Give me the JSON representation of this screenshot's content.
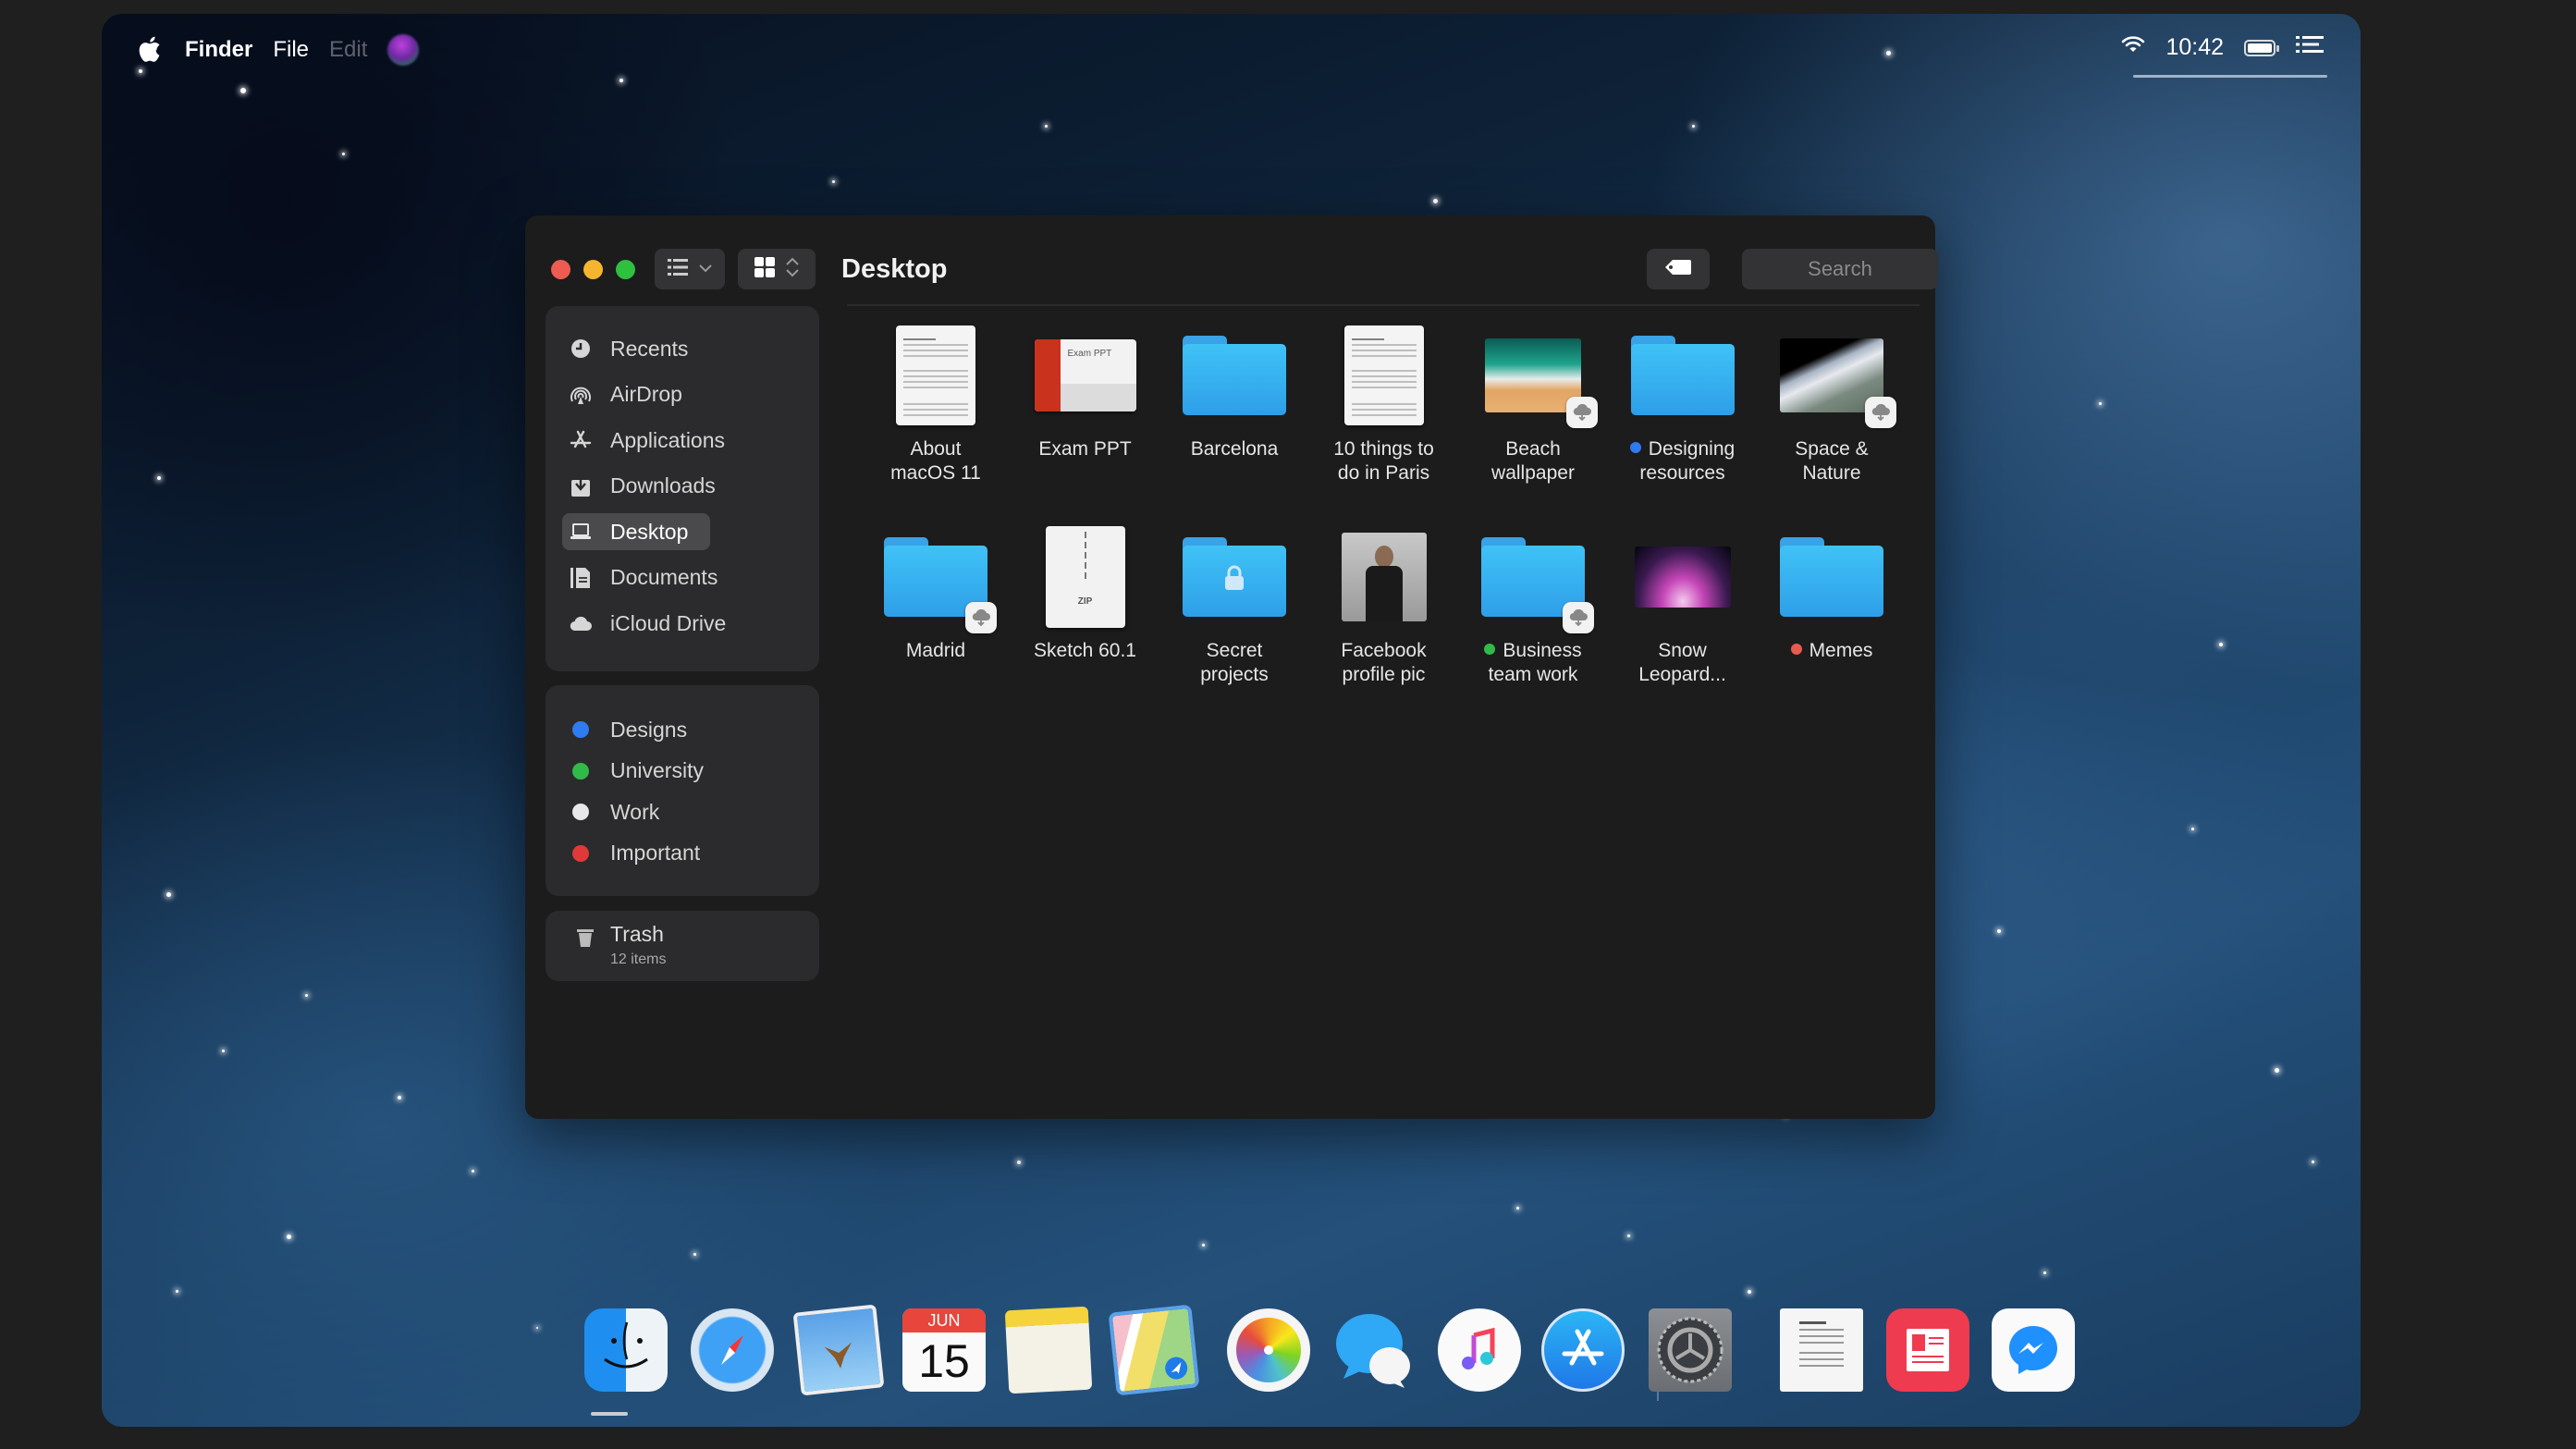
{
  "menubar": {
    "apple_icon": "apple-logo-icon",
    "app_name": "Finder",
    "items": [
      "File",
      "Edit"
    ],
    "time": "10:42",
    "status_icons": [
      "wifi-icon",
      "battery-icon",
      "control-center-list-icon"
    ]
  },
  "window": {
    "title": "Desktop",
    "view_buttons": [
      {
        "name": "list-view",
        "icon": "list-icon",
        "dropdown": "chevron-down-icon"
      },
      {
        "name": "icon-view",
        "icon": "grid-icon",
        "dropdown": "chevron-updown-icon"
      }
    ],
    "tag_button_icon": "tag-icon",
    "search_placeholder": "Search"
  },
  "sidebar": {
    "favorites": [
      {
        "label": "Recents",
        "icon": "clock-icon",
        "active": false
      },
      {
        "label": "AirDrop",
        "icon": "airdrop-icon",
        "active": false
      },
      {
        "label": "Applications",
        "icon": "applications-icon",
        "active": false
      },
      {
        "label": "Downloads",
        "icon": "download-icon",
        "active": false
      },
      {
        "label": "Desktop",
        "icon": "desktop-icon",
        "active": true
      },
      {
        "label": "Documents",
        "icon": "documents-icon",
        "active": false
      },
      {
        "label": "iCloud Drive",
        "icon": "cloud-icon",
        "active": false
      }
    ],
    "tags": [
      {
        "label": "Designs",
        "color": "#2f7bf0"
      },
      {
        "label": "University",
        "color": "#31b94a"
      },
      {
        "label": "Work",
        "color": "#e8e8e8"
      },
      {
        "label": "Important",
        "color": "#e0393a"
      }
    ],
    "trash": {
      "label": "Trash",
      "count": "12 items"
    }
  },
  "files": [
    {
      "name": "About macOS 11",
      "line1": "About",
      "line2": "macOS 11",
      "kind": "document",
      "tag": null,
      "cloud": false
    },
    {
      "name": "Exam PPT",
      "line1": "Exam PPT",
      "line2": "",
      "kind": "presentation",
      "tag": null,
      "cloud": false,
      "thumb_text": "Exam PPT"
    },
    {
      "name": "Barcelona",
      "line1": "Barcelona",
      "line2": "",
      "kind": "folder",
      "tag": null,
      "cloud": false
    },
    {
      "name": "10 things to do in Paris",
      "line1": "10 things to",
      "line2": "do in Paris",
      "kind": "document",
      "tag": null,
      "cloud": false
    },
    {
      "name": "Beach wallpaper",
      "line1": "Beach",
      "line2": "wallpaper",
      "kind": "image",
      "tag": null,
      "cloud": true
    },
    {
      "name": "Designing resources",
      "line1": "Designing",
      "line2": "resources",
      "kind": "folder",
      "tag": "#2f7bf0",
      "cloud": false
    },
    {
      "name": "Space & Nature",
      "line1": "Space &",
      "line2": "Nature",
      "kind": "image",
      "tag": null,
      "cloud": true
    },
    {
      "name": "Madrid",
      "line1": "Madrid",
      "line2": "",
      "kind": "folder",
      "tag": null,
      "cloud": true
    },
    {
      "name": "Sketch 60.1",
      "line1": "Sketch 60.1",
      "line2": "",
      "kind": "zip",
      "tag": null,
      "cloud": false,
      "thumb_text": "ZIP"
    },
    {
      "name": "Secret projects",
      "line1": "Secret",
      "line2": "projects",
      "kind": "locked-folder",
      "tag": null,
      "cloud": false
    },
    {
      "name": "Facebook profile pic",
      "line1": "Facebook",
      "line2": "profile pic",
      "kind": "photo",
      "tag": null,
      "cloud": false
    },
    {
      "name": "Business team work",
      "line1": "Business",
      "line2": "team work",
      "kind": "folder",
      "tag": "#31b94a",
      "cloud": true
    },
    {
      "name": "Snow Leopard...",
      "line1": "Snow",
      "line2": "Leopard...",
      "kind": "image",
      "tag": null,
      "cloud": false
    },
    {
      "name": "Memes",
      "line1": "Memes",
      "line2": "",
      "kind": "folder",
      "tag": "#e85a4f",
      "cloud": false
    }
  ],
  "dock": {
    "apps": [
      {
        "name": "Finder",
        "icon": "finder-icon",
        "running": true
      },
      {
        "name": "Safari",
        "icon": "safari-icon"
      },
      {
        "name": "Preview",
        "icon": "preview-icon"
      },
      {
        "name": "Calendar",
        "icon": "calendar-icon",
        "month": "JUN",
        "day": "15"
      },
      {
        "name": "Notes",
        "icon": "notes-icon"
      },
      {
        "name": "Maps",
        "icon": "maps-icon"
      },
      {
        "name": "Photos",
        "icon": "photos-icon"
      },
      {
        "name": "Messages",
        "icon": "messages-icon"
      },
      {
        "name": "Music",
        "icon": "music-icon"
      },
      {
        "name": "App Store",
        "icon": "app-store-icon"
      },
      {
        "name": "System Preferences",
        "icon": "system-preferences-icon"
      }
    ],
    "others": [
      {
        "name": "Documents stack",
        "icon": "document-stack-icon"
      },
      {
        "name": "News",
        "icon": "news-icon"
      },
      {
        "name": "Messenger",
        "icon": "messenger-icon"
      }
    ]
  }
}
